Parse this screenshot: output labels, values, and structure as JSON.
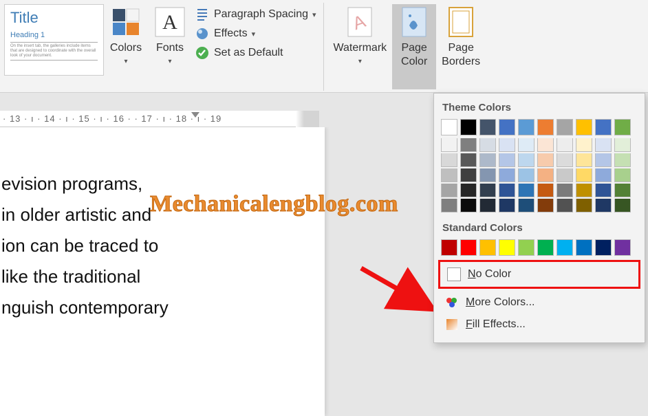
{
  "ribbon": {
    "theme_preview": {
      "title": "Title",
      "heading": "Heading 1"
    },
    "colors_label": "Colors",
    "fonts_label": "Fonts",
    "paragraph_spacing_label": "Paragraph Spacing",
    "effects_label": "Effects",
    "set_default_label": "Set as Default",
    "watermark_label": "Watermark",
    "page_color_label": "Page\nColor",
    "page_borders_label": "Page\nBorders"
  },
  "ruler": {
    "marks": "· 13 · ı · 14 · ı · 15 · ı · 16 ·   · 17 · ı · 18 · ı · 19"
  },
  "document": {
    "lines": [
      "evision programs,",
      "in older artistic and",
      "ion can be traced to",
      "like the traditional",
      "nguish contemporary"
    ]
  },
  "palette": {
    "theme_title": "Theme Colors",
    "standard_title": "Standard Colors",
    "no_color": "No Color",
    "more_colors": "More Colors...",
    "fill_effects": "Fill Effects...",
    "theme_row": [
      "#ffffff",
      "#000000",
      "#44546a",
      "#4472c4",
      "#5b9bd5",
      "#ed7d31",
      "#a5a5a5",
      "#ffc000",
      "#4472c4",
      "#70ad47"
    ],
    "theme_tints": [
      [
        "#f2f2f2",
        "#7f7f7f",
        "#d6dce4",
        "#d9e2f3",
        "#deebf6",
        "#fbe5d5",
        "#ededed",
        "#fff2cc",
        "#d9e2f3",
        "#e2efd9"
      ],
      [
        "#d8d8d8",
        "#595959",
        "#adb9ca",
        "#b4c6e7",
        "#bdd7ee",
        "#f7cbac",
        "#dbdbdb",
        "#fee599",
        "#b4c6e7",
        "#c5e0b3"
      ],
      [
        "#bfbfbf",
        "#3f3f3f",
        "#8496b0",
        "#8eaadb",
        "#9cc3e5",
        "#f4b183",
        "#c9c9c9",
        "#ffd965",
        "#8eaadb",
        "#a8d08d"
      ],
      [
        "#a5a5a5",
        "#262626",
        "#323f4f",
        "#2f5496",
        "#2e75b5",
        "#c55a11",
        "#7b7b7b",
        "#bf9000",
        "#2f5496",
        "#538135"
      ],
      [
        "#7f7f7f",
        "#0c0c0c",
        "#222a35",
        "#1f3864",
        "#1e4e79",
        "#833c0b",
        "#525252",
        "#7f6000",
        "#1f3864",
        "#375623"
      ]
    ],
    "standard_row": [
      "#c00000",
      "#ff0000",
      "#ffc000",
      "#ffff00",
      "#92d050",
      "#00b050",
      "#00b0f0",
      "#0070c0",
      "#002060",
      "#7030a0"
    ]
  },
  "watermark_text": "Mechanicalengblog.com"
}
